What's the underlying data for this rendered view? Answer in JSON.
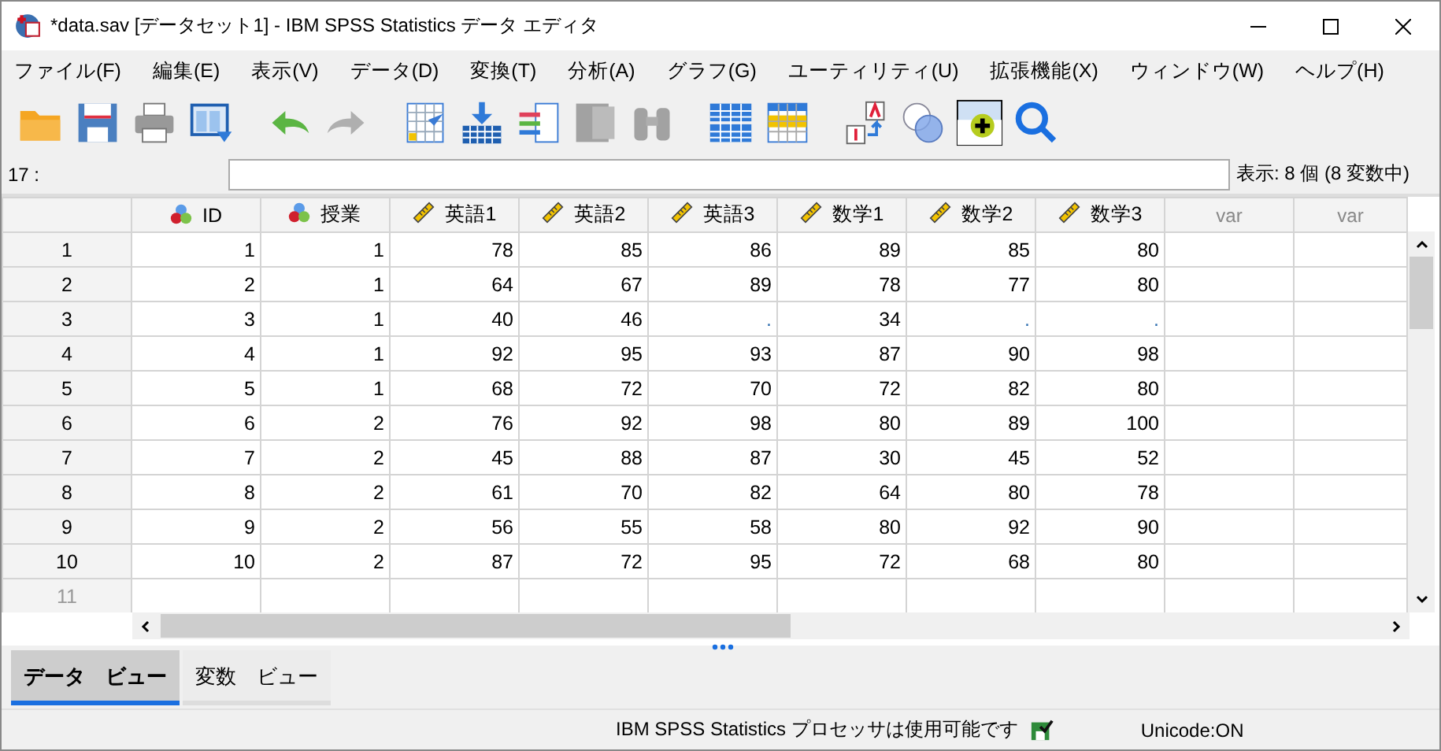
{
  "window": {
    "title": "*data.sav [データセット1] - IBM SPSS Statistics データ エディタ"
  },
  "menu": [
    "ファイル(F)",
    "編集(E)",
    "表示(V)",
    "データ(D)",
    "変換(T)",
    "分析(A)",
    "グラフ(G)",
    "ユーティリティ(U)",
    "拡張機能(X)",
    "ウィンドウ(W)",
    "ヘルプ(H)"
  ],
  "toolbar": [
    {
      "kind": "open",
      "disabled": false
    },
    {
      "kind": "save",
      "disabled": false
    },
    {
      "kind": "print",
      "disabled": false
    },
    {
      "kind": "dialog",
      "disabled": false
    },
    {
      "kind": "undo",
      "disabled": false
    },
    {
      "kind": "redo",
      "disabled": true
    },
    {
      "kind": "goto-case",
      "disabled": false
    },
    {
      "kind": "goto-var",
      "disabled": false
    },
    {
      "kind": "variables",
      "disabled": false
    },
    {
      "kind": "stats",
      "disabled": true
    },
    {
      "kind": "find",
      "disabled": true
    },
    {
      "kind": "split",
      "disabled": false
    },
    {
      "kind": "select",
      "disabled": false
    },
    {
      "kind": "labels",
      "disabled": false
    },
    {
      "kind": "sets",
      "disabled": false
    },
    {
      "kind": "custom",
      "disabled": false
    },
    {
      "kind": "search",
      "disabled": false
    }
  ],
  "cell_editor": {
    "cell_ref": "17 :",
    "visible_count": "表示: 8 個 (8 変数中)"
  },
  "table": {
    "columns": [
      {
        "label": "ID",
        "kind": "nominal"
      },
      {
        "label": "授業",
        "kind": "nominal"
      },
      {
        "label": "英語1",
        "kind": "scale"
      },
      {
        "label": "英語2",
        "kind": "scale"
      },
      {
        "label": "英語3",
        "kind": "scale"
      },
      {
        "label": "数学1",
        "kind": "scale"
      },
      {
        "label": "数学2",
        "kind": "scale"
      },
      {
        "label": "数学3",
        "kind": "scale"
      },
      {
        "label": "var",
        "kind": "empty"
      },
      {
        "label": "var",
        "kind": "empty"
      }
    ],
    "rows": [
      {
        "n": "1",
        "cells": [
          "1",
          "1",
          "78",
          "85",
          "86",
          "89",
          "85",
          "80"
        ],
        "placeholder_row": false
      },
      {
        "n": "2",
        "cells": [
          "2",
          "1",
          "64",
          "67",
          "89",
          "78",
          "77",
          "80"
        ],
        "placeholder_row": false
      },
      {
        "n": "3",
        "cells": [
          "3",
          "1",
          "40",
          "46",
          ".",
          "34",
          ".",
          "."
        ],
        "placeholder_row": false
      },
      {
        "n": "4",
        "cells": [
          "4",
          "1",
          "92",
          "95",
          "93",
          "87",
          "90",
          "98"
        ],
        "placeholder_row": false
      },
      {
        "n": "5",
        "cells": [
          "5",
          "1",
          "68",
          "72",
          "70",
          "72",
          "82",
          "80"
        ],
        "placeholder_row": false
      },
      {
        "n": "6",
        "cells": [
          "6",
          "2",
          "76",
          "92",
          "98",
          "80",
          "89",
          "100"
        ],
        "placeholder_row": false
      },
      {
        "n": "7",
        "cells": [
          "7",
          "2",
          "45",
          "88",
          "87",
          "30",
          "45",
          "52"
        ],
        "placeholder_row": false
      },
      {
        "n": "8",
        "cells": [
          "8",
          "2",
          "61",
          "70",
          "82",
          "64",
          "80",
          "78"
        ],
        "placeholder_row": false
      },
      {
        "n": "9",
        "cells": [
          "9",
          "2",
          "56",
          "55",
          "58",
          "80",
          "92",
          "90"
        ],
        "placeholder_row": false
      },
      {
        "n": "10",
        "cells": [
          "10",
          "2",
          "87",
          "72",
          "95",
          "72",
          "68",
          "80"
        ],
        "placeholder_row": false
      },
      {
        "n": "11",
        "cells": [],
        "placeholder_row": true
      }
    ]
  },
  "tabs": [
    {
      "label": "データ　ビュー",
      "selected": true
    },
    {
      "label": "変数　ビュー",
      "selected": false
    }
  ],
  "status_bar": {
    "message": "IBM SPSS Statistics プロセッサは使用可能です",
    "encoding": "Unicode:ON"
  }
}
